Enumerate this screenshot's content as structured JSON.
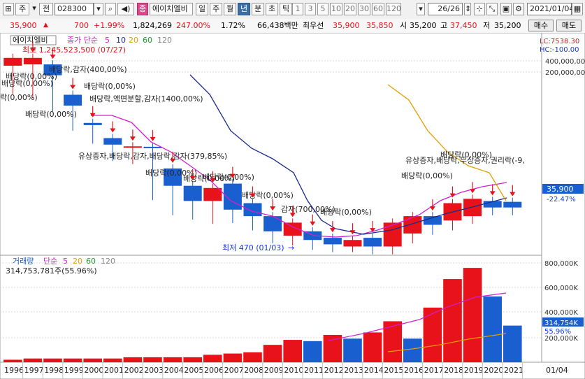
{
  "toolbar": {
    "type_label": "주",
    "prefix_label": "전",
    "code": "028300",
    "stock_badge": "종",
    "stock_name": "에이치엘비",
    "periods": [
      "일",
      "주",
      "월",
      "년",
      "분",
      "초",
      "틱"
    ],
    "active_period": "년",
    "minute_steps": [
      "1",
      "3",
      "5",
      "10",
      "20",
      "30",
      "60",
      "120"
    ],
    "page_counter": "26/26",
    "date": "2021/01/04"
  },
  "quote": {
    "price": "35,900",
    "change": "700",
    "change_pct": "+1.99%",
    "volume": "1,824,269",
    "volume_ratio": "247.00%",
    "turnover": "1.72%",
    "amount": "66,438백만",
    "best_ask_label": "최우선",
    "best_ask": "35,900",
    "best_bid": "35,850",
    "open_label": "시",
    "open": "35,200",
    "high_label": "고",
    "high": "37,450",
    "low_label": "저",
    "low": "35,200",
    "buy_label": "매수",
    "sell_label": "매도"
  },
  "price_panel": {
    "legend_name": "에이치엘비",
    "legend_ma_label": "종가 단순",
    "legend_ma": [
      "5",
      "10",
      "20",
      "60",
      "120"
    ],
    "lc_label": "LC:7538.30",
    "hc_label": "HC:-100.00",
    "high_note": "최고 1,245,523,500 (07/27)",
    "low_note": "최저 470 (01/03)",
    "axis_labels": [
      "400,000,00",
      "200,000,00"
    ],
    "current_price": "35,900",
    "current_pct": "-22.47%",
    "annotations": [
      "배당락(0,00%)",
      "배당락(0,00%)",
      "락(0,00%)",
      "배당락,감자(400,00%)",
      "배당락(0,00%)",
      "배당락(0,00%)",
      "배당락,액면분할,감자(1400,00%)",
      "유상증자,배당락,감자,배당락,감자(379,85%)",
      "배당락(0,00%)",
      "배당락(0,00%)",
      "배당락(0,00%)",
      "배당락(0,00%)",
      "감자(700,00%)",
      "배당락(0,00%)",
      "배당락(0,00%)",
      "유상증자,배당락,무상증자,권리락(-9,",
      "배당락(0,00%)"
    ]
  },
  "volume_panel": {
    "legend_name": "거래량",
    "legend_ma_label": "단순",
    "legend_ma": [
      "5",
      "20",
      "60",
      "120"
    ],
    "summary": "314,753,781주(55.96%)",
    "axis_labels": [
      "800,000K",
      "600,000K",
      "400,000K",
      "200,000K"
    ],
    "current_volume": "314,754K",
    "current_pct": "55.96%"
  },
  "x_axis_end_label": "01/04",
  "colors": {
    "up": "#e8121b",
    "down": "#1a5fd0",
    "ma5": "#d020d0",
    "ma10": "#1a2a8c",
    "ma20": "#e0a000"
  },
  "chart_data": {
    "type": "candlestick",
    "categories": [
      "1996",
      "1997",
      "1998",
      "1999",
      "2000",
      "2001",
      "2002",
      "2003",
      "2004",
      "2005",
      "2006",
      "2007",
      "2008",
      "2009",
      "2010",
      "2011",
      "2012",
      "2013",
      "2014",
      "2015",
      "2016",
      "2017",
      "2018",
      "2019",
      "2020",
      "2021"
    ],
    "price_ohlc_axis_units": [
      {
        "o": 392,
        "h": 380,
        "l": 340,
        "c": 410,
        "up": true
      },
      {
        "o": 395,
        "h": 380,
        "l": 330,
        "c": 410,
        "up": true
      },
      {
        "o": 370,
        "h": 355,
        "l": 300,
        "c": 395,
        "up": false
      },
      {
        "o": 300,
        "h": 285,
        "l": 255,
        "c": 325,
        "up": false
      },
      {
        "o": 255,
        "h": 240,
        "l": 225,
        "c": 260,
        "up": false
      },
      {
        "o": 210,
        "h": 195,
        "l": 185,
        "c": 225,
        "up": false
      },
      {
        "o": 205,
        "h": 200,
        "l": 178,
        "c": 206,
        "up": true
      },
      {
        "o": 205,
        "h": 180,
        "l": 95,
        "c": 205,
        "up": false
      },
      {
        "o": 115,
        "h": 100,
        "l": 60,
        "c": 155,
        "up": false
      },
      {
        "o": 80,
        "h": 68,
        "l": 50,
        "c": 115,
        "up": false
      },
      {
        "o": 80,
        "h": 58,
        "l": 40,
        "c": 110,
        "up": true
      },
      {
        "o": 60,
        "h": 50,
        "l": 42,
        "c": 120,
        "up": false
      },
      {
        "o": 45,
        "h": 30,
        "l": 25,
        "c": 75,
        "up": false
      },
      {
        "o": 10,
        "h": 0,
        "l": -5,
        "c": 45,
        "up": false
      },
      {
        "o": 0,
        "h": -5,
        "l": -10,
        "c": 30,
        "up": true
      },
      {
        "o": -10,
        "h": -20,
        "l": -20,
        "c": 10,
        "up": false
      },
      {
        "o": -20,
        "h": -25,
        "l": -25,
        "c": -5,
        "up": false
      },
      {
        "o": -25,
        "h": -25,
        "l": -25,
        "c": -10,
        "up": true
      },
      {
        "o": -25,
        "h": -25,
        "l": -30,
        "c": -5,
        "up": false
      },
      {
        "o": -25,
        "h": -5,
        "l": -30,
        "c": 30,
        "up": true
      },
      {
        "o": 5,
        "h": 25,
        "l": -5,
        "c": 45,
        "up": true
      },
      {
        "o": 25,
        "h": 45,
        "l": 15,
        "c": 45,
        "up": false
      },
      {
        "o": 35,
        "h": 55,
        "l": 25,
        "c": 75,
        "up": true
      },
      {
        "o": 45,
        "h": 70,
        "l": 40,
        "c": 85,
        "up": true
      },
      {
        "o": 65,
        "h": 75,
        "l": 60,
        "c": 80,
        "up": false
      },
      {
        "o": 65,
        "h": 72,
        "l": 60,
        "c": 78,
        "up": false
      }
    ],
    "volume_k": [
      20,
      30,
      30,
      30,
      30,
      30,
      40,
      40,
      40,
      40,
      60,
      70,
      80,
      140,
      180,
      170,
      220,
      190,
      240,
      330,
      190,
      440,
      670,
      760,
      530,
      295
    ],
    "volume_up": [
      true,
      true,
      true,
      true,
      true,
      true,
      true,
      true,
      true,
      true,
      true,
      true,
      true,
      true,
      true,
      false,
      true,
      false,
      true,
      true,
      false,
      true,
      true,
      true,
      false,
      false
    ]
  }
}
